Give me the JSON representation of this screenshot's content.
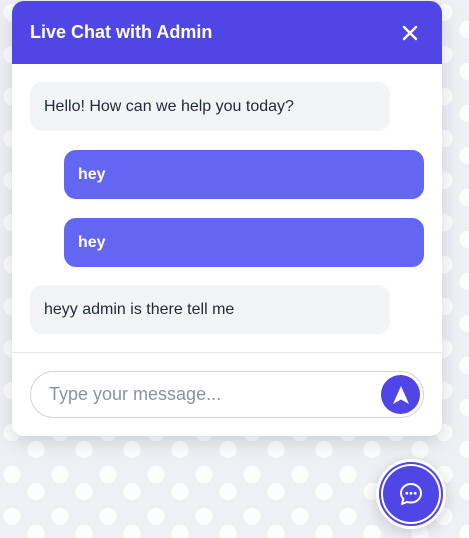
{
  "chat": {
    "title": "Live Chat with Admin",
    "close_icon": "close-icon",
    "messages": [
      {
        "sender": "admin",
        "text": "Hello! How can we help you today?"
      },
      {
        "sender": "user",
        "text": "hey"
      },
      {
        "sender": "user",
        "text": "hey"
      },
      {
        "sender": "admin",
        "text": "heyy admin is there tell me"
      }
    ],
    "input": {
      "value": "",
      "placeholder": "Type your message..."
    },
    "send_icon": "send-icon"
  },
  "launcher": {
    "icon": "chat-bubble-icon"
  },
  "colors": {
    "accent": "#4f46e5",
    "user_bubble": "#6366f1",
    "admin_bubble": "#f3f4f6",
    "background": "#eef0f4"
  }
}
